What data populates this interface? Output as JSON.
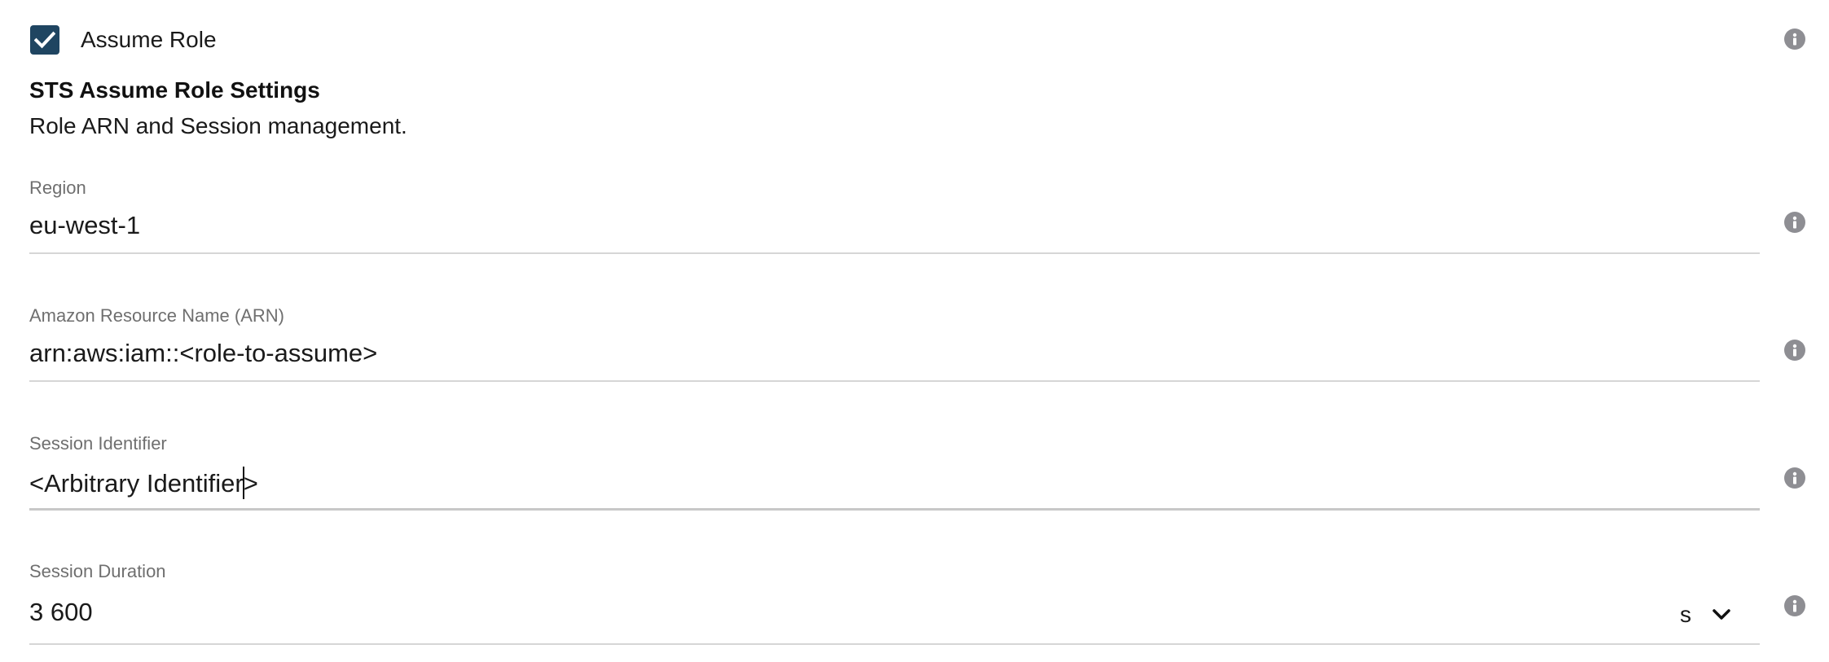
{
  "assume_role": {
    "label": "Assume Role",
    "checked": true
  },
  "section": {
    "title": "STS Assume Role Settings",
    "description": "Role ARN and Session management."
  },
  "fields": {
    "region": {
      "label": "Region",
      "value": "eu-west-1"
    },
    "arn": {
      "label": "Amazon Resource Name (ARN)",
      "value": "arn:aws:iam::<role-to-assume>"
    },
    "session_identifier": {
      "label": "Session Identifier",
      "value_before_caret": "<Arbitrary Identifier",
      "value_after_caret": ">"
    },
    "session_duration": {
      "label": "Session Duration",
      "value": "3 600",
      "unit": "s"
    }
  },
  "colors": {
    "checkbox_fill": "#1f4561",
    "info_icon": "#8e8e93",
    "label_gray": "#6f6f6f",
    "underline": "#d6d6d6"
  },
  "icons": {
    "checkbox": "checkmark-icon",
    "info": "info-icon",
    "dropdown": "chevron-down-icon"
  }
}
